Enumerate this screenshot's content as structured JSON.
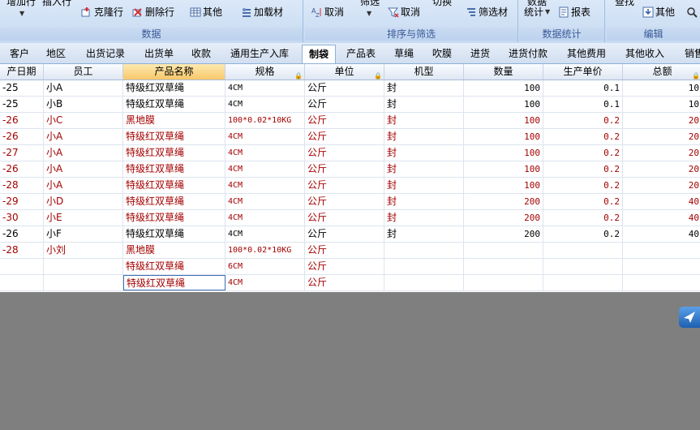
{
  "ribbon": {
    "groups": {
      "data": {
        "label": "数据"
      },
      "sort_filter": {
        "label": "排序与筛选"
      },
      "stats": {
        "label": "数据统计"
      },
      "edit": {
        "label": "编辑"
      }
    },
    "top_cut": {
      "add_row": "增加行",
      "insert_row": "插入行",
      "filter_top": "筛选",
      "switch_top": "切换",
      "stats_top": "数据",
      "find_top": "查找"
    },
    "buttons": {
      "clone_row": "克隆行",
      "delete_row": "删除行",
      "other": "其他",
      "load_material": "加载材",
      "cancel_sort": "取消",
      "cancel_filter": "取消",
      "filter_material": "筛选材",
      "stats": "统计",
      "report": "报表",
      "edit_other": "其他"
    }
  },
  "tabs": [
    {
      "label": "客户"
    },
    {
      "label": "地区"
    },
    {
      "label": "出货记录"
    },
    {
      "label": "出货单"
    },
    {
      "label": "收款"
    },
    {
      "label": "通用生产入库"
    },
    {
      "label": "制袋"
    },
    {
      "label": "产品表"
    },
    {
      "label": "草绳"
    },
    {
      "label": "吹膜"
    },
    {
      "label": "进货"
    },
    {
      "label": "进货付款"
    },
    {
      "label": "其他费用"
    },
    {
      "label": "其他收入"
    },
    {
      "label": "销售"
    }
  ],
  "table": {
    "headers": [
      "产日期",
      "员工",
      "产品名称",
      "规格",
      "单位",
      "机型",
      "数量",
      "生产单价",
      "总额"
    ],
    "rows": [
      {
        "date": "-25",
        "emp": "小A",
        "product": "特级红双草绳",
        "spec": "4CM",
        "unit": "公斤",
        "model": "封",
        "qty": "100",
        "price": "0.1",
        "total": "10",
        "red": false
      },
      {
        "date": "-25",
        "emp": "小B",
        "product": "特级红双草绳",
        "spec": "4CM",
        "unit": "公斤",
        "model": "封",
        "qty": "100",
        "price": "0.1",
        "total": "10",
        "red": false
      },
      {
        "date": "-26",
        "emp": "小C",
        "product": "黑地膜",
        "spec": "100*0.02*10KG",
        "unit": "公斤",
        "model": "封",
        "qty": "100",
        "price": "0.2",
        "total": "20",
        "red": true
      },
      {
        "date": "-26",
        "emp": "小A",
        "product": "特级红双草绳",
        "spec": "4CM",
        "unit": "公斤",
        "model": "封",
        "qty": "100",
        "price": "0.2",
        "total": "20",
        "red": true
      },
      {
        "date": "-27",
        "emp": "小A",
        "product": "特级红双草绳",
        "spec": "4CM",
        "unit": "公斤",
        "model": "封",
        "qty": "100",
        "price": "0.2",
        "total": "20",
        "red": true
      },
      {
        "date": "-26",
        "emp": "小A",
        "product": "特级红双草绳",
        "spec": "4CM",
        "unit": "公斤",
        "model": "封",
        "qty": "100",
        "price": "0.2",
        "total": "20",
        "red": true
      },
      {
        "date": "-28",
        "emp": "小A",
        "product": "特级红双草绳",
        "spec": "4CM",
        "unit": "公斤",
        "model": "封",
        "qty": "100",
        "price": "0.2",
        "total": "20",
        "red": true
      },
      {
        "date": "-29",
        "emp": "小D",
        "product": "特级红双草绳",
        "spec": "4CM",
        "unit": "公斤",
        "model": "封",
        "qty": "200",
        "price": "0.2",
        "total": "40",
        "red": true
      },
      {
        "date": "-30",
        "emp": "小E",
        "product": "特级红双草绳",
        "spec": "4CM",
        "unit": "公斤",
        "model": "封",
        "qty": "200",
        "price": "0.2",
        "total": "40",
        "red": true
      },
      {
        "date": "-26",
        "emp": "小F",
        "product": "特级红双草绳",
        "spec": "4CM",
        "unit": "公斤",
        "model": "封",
        "qty": "200",
        "price": "0.2",
        "total": "40",
        "red": false
      },
      {
        "date": "-28",
        "emp": "小刘",
        "product": "黑地膜",
        "spec": "100*0.02*10KG",
        "unit": "公斤",
        "model": "",
        "qty": "",
        "price": "",
        "total": "",
        "red": true
      },
      {
        "date": "",
        "emp": "",
        "product": "特级红双草绳",
        "spec": "6CM",
        "unit": "公斤",
        "model": "",
        "qty": "",
        "price": "",
        "total": "",
        "red": true
      },
      {
        "date": "",
        "emp": "",
        "product": "特级红双草绳",
        "spec": "4CM",
        "unit": "公斤",
        "model": "",
        "qty": "",
        "price": "",
        "total": "",
        "red": true
      }
    ]
  },
  "colors": {
    "accent": "#3d6fb5",
    "red_text": "#a40000",
    "background": "#7f7f7f"
  }
}
